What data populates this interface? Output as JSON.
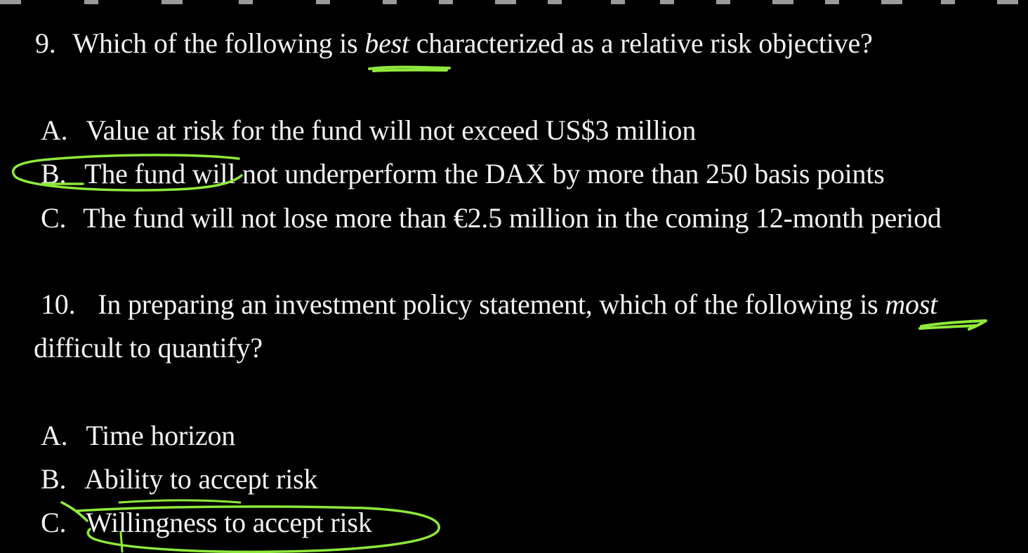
{
  "annotation_color": "#8fe83c",
  "question9": {
    "number": "9.",
    "text_before": "Which of the following is",
    "emphasis": "best",
    "text_after": "characterized as a relative risk objective?",
    "options": [
      {
        "letter": "A.",
        "text": "Value at risk for the fund will not exceed US$3 million"
      },
      {
        "letter": "B.",
        "text": "The fund will not underperform the DAX by more than 250 basis points"
      },
      {
        "letter": "C.",
        "text": "The fund will not lose more than €2.5 million in the coming 12-month period"
      }
    ]
  },
  "question10": {
    "number": "10.",
    "text_before": "In preparing an investment policy statement, which of the following is",
    "emphasis": "most",
    "line2": "difficult to quantify?",
    "options": [
      {
        "letter": "A.",
        "text": "Time horizon"
      },
      {
        "letter": "B.",
        "text": "Ability to accept risk"
      },
      {
        "letter": "C.",
        "text": "Willingness to accept risk"
      }
    ]
  }
}
